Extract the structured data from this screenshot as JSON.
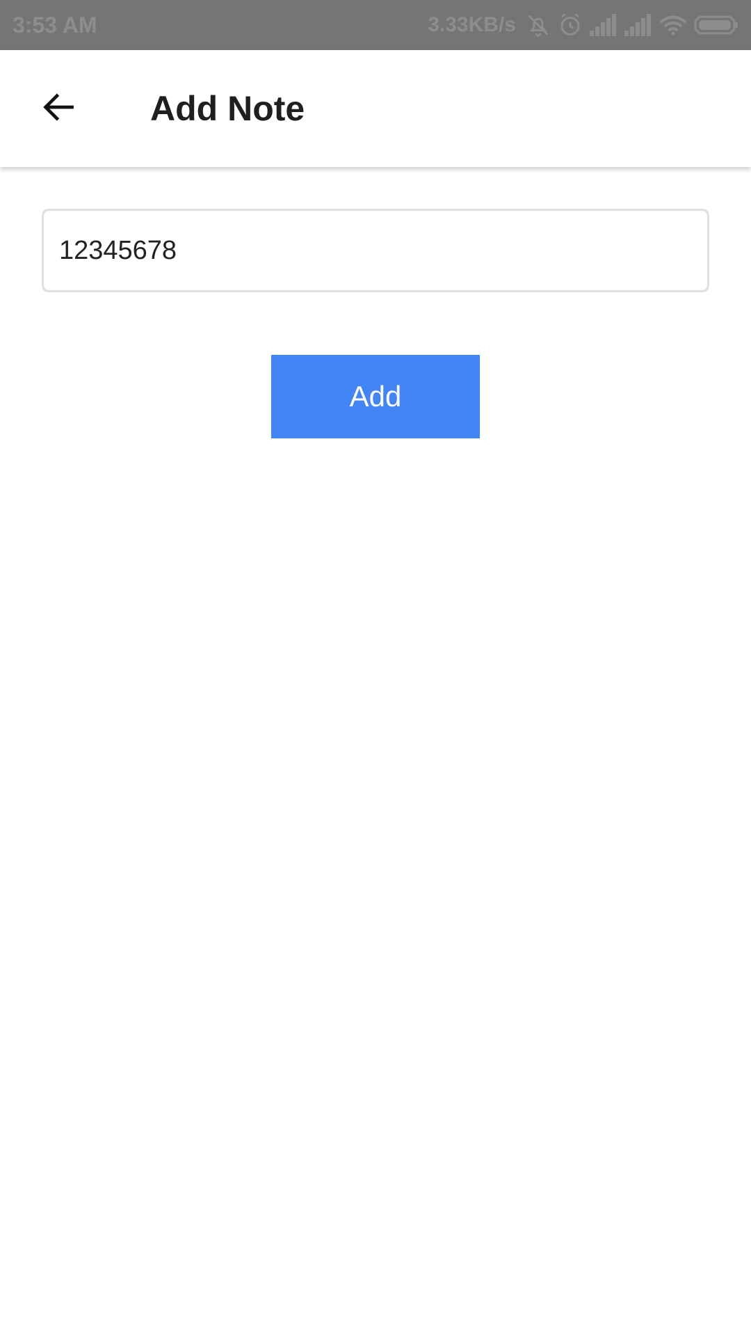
{
  "status_bar": {
    "time": "3:53 AM",
    "network_speed": "3.33KB/s",
    "icons": [
      "bell-muted-icon",
      "alarm-icon",
      "signal-icon",
      "signal-icon",
      "wifi-icon",
      "battery-icon"
    ]
  },
  "app_bar": {
    "back_icon": "arrow-left-icon",
    "title": "Add Note"
  },
  "form": {
    "note_value": "12345678",
    "add_label": "Add"
  },
  "colors": {
    "status_bar_bg": "#757575",
    "accent_button": "#4285f4",
    "title_text": "#1f1f1f"
  }
}
